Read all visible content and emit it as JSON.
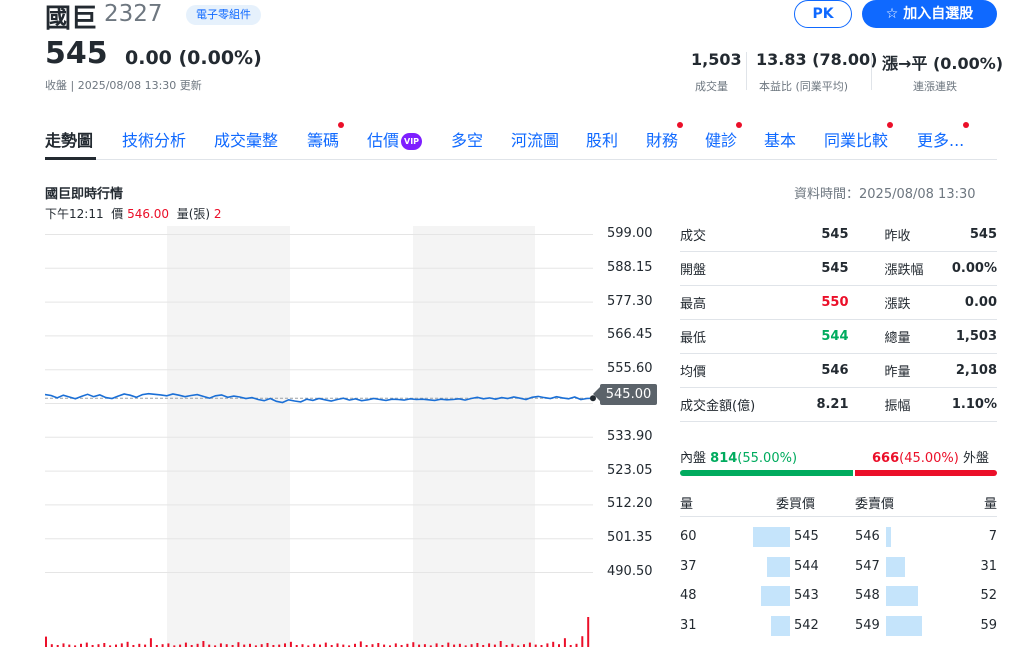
{
  "stock": {
    "name": "國巨",
    "code": "2327",
    "category": "電子零組件",
    "price": "545",
    "change": "0.00 (0.00%)",
    "close_info": "收盤 | 2025/08/08 13:30 更新"
  },
  "actions": {
    "pk": "PK",
    "add": "☆  加入自選股"
  },
  "stats": [
    {
      "value": "1,503",
      "label": "成交量"
    },
    {
      "value": "13.83 (78.00)",
      "label": "本益比 (同業平均)"
    },
    {
      "value": "漲→平 (0.00%)",
      "label": "連漲連跌"
    }
  ],
  "tabs": [
    {
      "label": "走勢圖",
      "dot": false
    },
    {
      "label": "技術分析",
      "dot": false
    },
    {
      "label": "成交彙整",
      "dot": false
    },
    {
      "label": "籌碼",
      "dot": true
    },
    {
      "label": "估價",
      "dot": false,
      "vip": "VIP"
    },
    {
      "label": "多空",
      "dot": false
    },
    {
      "label": "河流圖",
      "dot": false
    },
    {
      "label": "股利",
      "dot": false
    },
    {
      "label": "財務",
      "dot": true
    },
    {
      "label": "健診",
      "dot": true
    },
    {
      "label": "基本",
      "dot": false
    },
    {
      "label": "同業比較",
      "dot": true
    },
    {
      "label": "更多...",
      "dot": true
    }
  ],
  "section": {
    "title": "國巨即時行情",
    "data_time": "資料時間：2025/08/08 13:30",
    "hover_time": "下午12:11",
    "hover_price_label": "價",
    "hover_price": "546.00",
    "hover_vol_label": "量(張)",
    "hover_vol": "2"
  },
  "chart_data": {
    "type": "line",
    "y_ticks": [
      "599.00",
      "588.15",
      "577.30",
      "566.45",
      "555.60",
      "545.00",
      "533.90",
      "523.05",
      "512.20",
      "501.35",
      "490.50"
    ],
    "ylim": [
      490.5,
      599.0
    ],
    "reference": 545.0,
    "last_price": "545.00",
    "series": [
      {
        "values": [
          546.2,
          545.9,
          545.1,
          546.0,
          545.4,
          544.8,
          545.6,
          546.3,
          545.5,
          546.1,
          545.2,
          544.9,
          545.7,
          546.4,
          546.0,
          545.3,
          546.2,
          546.5,
          546.3,
          546.1,
          545.8,
          546.4,
          546.0,
          545.5,
          545.9,
          546.2,
          545.6,
          545.0,
          545.8,
          546.1,
          545.3,
          545.7,
          545.4,
          544.9,
          545.2,
          544.6,
          544.2,
          544.9,
          544.0,
          543.6,
          544.5,
          544.1,
          543.8,
          544.7,
          544.3,
          544.9,
          544.5,
          544.1,
          544.6,
          545.0,
          544.4,
          544.8,
          544.2,
          544.5,
          544.9,
          544.6,
          544.3,
          544.7,
          544.6,
          544.4,
          544.8,
          544.6,
          544.7,
          544.5,
          544.3,
          544.7,
          544.5,
          544.6,
          544.8,
          544.4,
          544.9,
          545.3,
          544.8,
          545.1,
          544.7,
          545.2,
          544.9,
          545.4,
          545.0,
          544.6,
          545.3,
          545.6,
          545.2,
          544.9,
          545.5,
          545.1,
          544.8,
          545.4,
          544.6,
          544.9,
          545.0
        ]
      }
    ],
    "volumes": [
      26,
      7,
      5,
      9,
      6,
      4,
      8,
      11,
      5,
      7,
      10,
      4,
      6,
      9,
      13,
      5,
      8,
      6,
      22,
      5,
      7,
      9,
      4,
      6,
      11,
      5,
      8,
      15,
      6,
      4,
      9,
      7,
      5,
      12,
      6,
      8,
      4,
      7,
      10,
      5,
      6,
      9,
      13,
      5,
      7,
      4,
      8,
      6,
      11,
      5,
      9,
      6,
      4,
      8,
      14,
      5,
      7,
      10,
      6,
      4,
      9,
      5,
      8,
      12,
      6,
      7,
      4,
      9,
      5,
      11,
      6,
      8,
      4,
      7,
      10,
      5,
      9,
      6,
      15,
      5,
      8,
      4,
      7,
      11,
      6,
      5,
      9,
      13,
      7,
      22,
      5,
      8,
      27,
      75
    ]
  },
  "quote": [
    {
      "l1": "成交",
      "v1": "545",
      "c1": "",
      "l2": "昨收",
      "v2": "545",
      "c2": ""
    },
    {
      "l1": "開盤",
      "v1": "545",
      "c1": "",
      "l2": "漲跌幅",
      "v2": "0.00%",
      "c2": ""
    },
    {
      "l1": "最高",
      "v1": "550",
      "c1": "up",
      "l2": "漲跌",
      "v2": "0.00",
      "c2": ""
    },
    {
      "l1": "最低",
      "v1": "544",
      "c1": "down",
      "l2": "總量",
      "v2": "1,503",
      "c2": ""
    },
    {
      "l1": "均價",
      "v1": "546",
      "c1": "",
      "l2": "昨量",
      "v2": "2,108",
      "c2": ""
    },
    {
      "l1": "成交金額(億)",
      "v1": "8.21",
      "c1": "",
      "l2": "振幅",
      "v2": "1.10%",
      "c2": ""
    }
  ],
  "inout": {
    "in_label": "內盤",
    "in_value": "814",
    "in_pct": "(55.00%)",
    "out_value": "666",
    "out_pct": "(45.00%)",
    "out_label": "外盤",
    "in_share": 0.55
  },
  "orderbook": {
    "headers": {
      "bid_vol": "量",
      "bid_price": "委買價",
      "ask_price": "委賣價",
      "ask_vol": "量"
    },
    "rows": [
      {
        "bid_vol": "60",
        "bid_price": "545",
        "ask_price": "546",
        "ask_vol": "7",
        "bid_frac": 0.62,
        "ask_frac": 0.08
      },
      {
        "bid_vol": "37",
        "bid_price": "544",
        "ask_price": "547",
        "ask_vol": "31",
        "bid_frac": 0.38,
        "ask_frac": 0.32
      },
      {
        "bid_vol": "48",
        "bid_price": "543",
        "ask_price": "548",
        "ask_vol": "52",
        "bid_frac": 0.49,
        "ask_frac": 0.53
      },
      {
        "bid_vol": "31",
        "bid_price": "542",
        "ask_price": "549",
        "ask_vol": "59",
        "bid_frac": 0.32,
        "ask_frac": 0.6
      }
    ]
  }
}
